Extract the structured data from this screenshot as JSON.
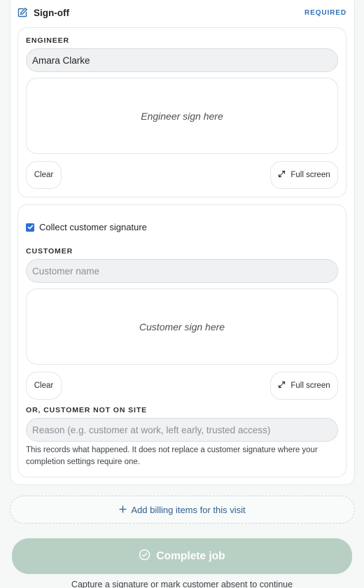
{
  "header": {
    "title": "Sign-off",
    "badge": "REQUIRED",
    "icon": "edit-note-icon"
  },
  "engineer": {
    "label": "ENGINEER",
    "name_value": "Amara Clarke",
    "pad_text": "Engineer sign here",
    "clear_label": "Clear",
    "fullscreen_label": "Full screen"
  },
  "customer": {
    "collect_label": "Collect customer signature",
    "collect_checked": true,
    "label": "CUSTOMER",
    "name_placeholder": "Customer name",
    "pad_text": "Customer sign here",
    "clear_label": "Clear",
    "fullscreen_label": "Full screen",
    "absent_label": "OR, CUSTOMER NOT ON SITE",
    "reason_placeholder": "Reason (e.g. customer at work, left early, trusted access)",
    "help_text": "This records what happened. It does not replace a customer signature where your completion settings require one."
  },
  "billing": {
    "label": "Add billing items for this visit",
    "icon": "plus-icon"
  },
  "complete": {
    "label": "Complete job",
    "icon": "check-circle-icon",
    "hint": "Capture a signature or mark customer absent to continue"
  },
  "colors": {
    "accent": "#2f6fd6",
    "badge": "#2f6fb2",
    "complete_disabled": "#b8cfc3"
  }
}
